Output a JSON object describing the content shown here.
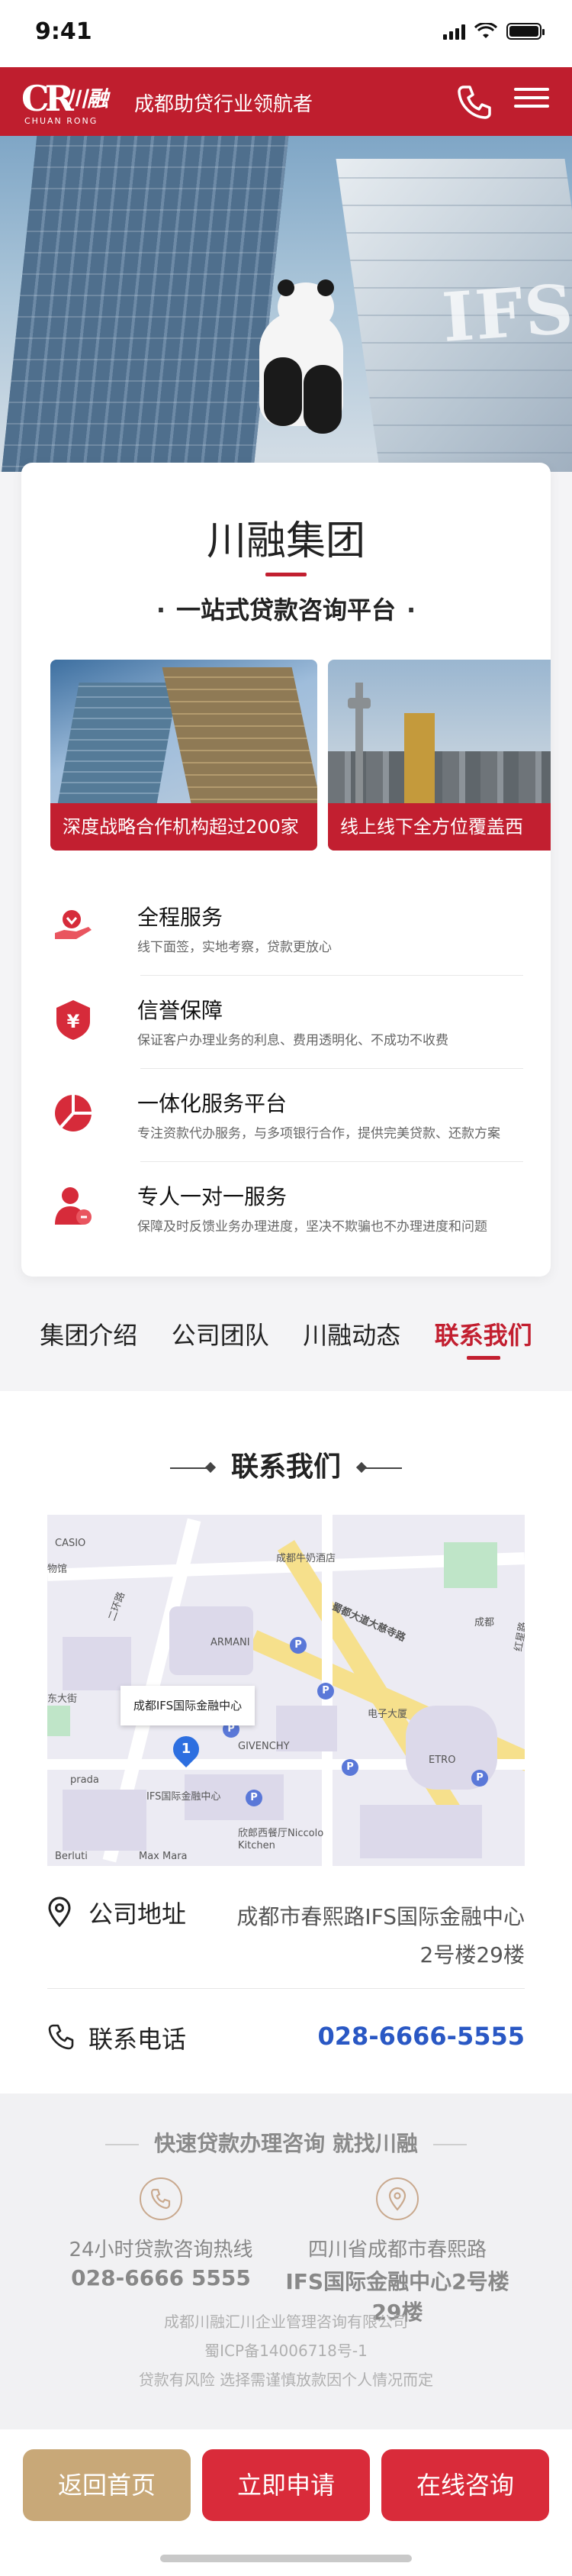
{
  "status_bar": {
    "time": "9:41"
  },
  "header": {
    "logo_mark": "CR",
    "logo_cn": "川融",
    "logo_en": "CHUAN RONG",
    "slogan": "成都助贷行业领航者"
  },
  "intro": {
    "title": "川融集团",
    "subtitle": "一站式贷款咨询平台",
    "slides": [
      {
        "caption": "深度战略合作机构超过200家"
      },
      {
        "caption": "线上线下全方位覆盖西"
      }
    ],
    "features": [
      {
        "title": "全程服务",
        "desc": "线下面签，实地考察，贷款更放心",
        "icon": "hand-heart-icon"
      },
      {
        "title": "信誉保障",
        "desc": "保证客户办理业务的利息、费用透明化、不成功不收费",
        "icon": "shield-yen-icon"
      },
      {
        "title": "一体化服务平台",
        "desc": "专注资款代办服务，与多项银行合作，提供完美贷款、还款方案",
        "icon": "pie-chart-icon"
      },
      {
        "title": "专人一对一服务",
        "desc": "保障及时反馈业务办理进度，坚决不欺骗也不办理进度和问题",
        "icon": "person-service-icon"
      }
    ]
  },
  "tabs": [
    {
      "label": "集团介绍",
      "active": false
    },
    {
      "label": "公司团队",
      "active": false
    },
    {
      "label": "川融动态",
      "active": false
    },
    {
      "label": "联系我们",
      "active": true
    }
  ],
  "contact": {
    "heading": "联系我们",
    "map": {
      "callout": "成都IFS国际金融中心",
      "pin_number": "1",
      "labels": {
        "casio": "CASIO",
        "wuguan": "物馆",
        "jiuyan": "成都牛奶酒店",
        "armani": "ARMANI",
        "dongda": "东大街",
        "road": "蜀都大道大慈寺路",
        "dianzi": "电子大厦",
        "givenchy": "GIVENCHY",
        "prada": "prada",
        "ifs": "IFS国际金融中心",
        "niccolo": "欣郎西餐厅Niccolo Kitchen",
        "berluti": "Berluti",
        "maxmara": "Max Mara",
        "etro": "ETRO",
        "erhuan": "二环路",
        "chengbei": "成都",
        "hongxing": "红星路"
      }
    },
    "address_label": "公司地址",
    "address_value": "成都市春熙路IFS国际金融中心2号楼29楼",
    "phone_label": "联系电话",
    "phone_value": "028-6666-5555"
  },
  "footer": {
    "slogan": "快速贷款办理咨询 就找川融",
    "left_line1": "24小时贷款咨询热线",
    "left_line2": "028-6666 5555",
    "right_line1": "四川省成都市春熙路",
    "right_line2": "IFS国际金融中心2号楼29楼",
    "company": "成都川融汇川企业管理咨询有限公司",
    "icp": "蜀ICP备14006718号-1",
    "risk": "贷款有风险 选择需谨慎放款因个人情况而定"
  },
  "bottom_bar": {
    "home": "返回首页",
    "apply": "立即申请",
    "consult": "在线咨询"
  },
  "colors": {
    "brand_red": "#bf1e2e",
    "gold": "#c8a878",
    "link_blue": "#2a58c4"
  }
}
